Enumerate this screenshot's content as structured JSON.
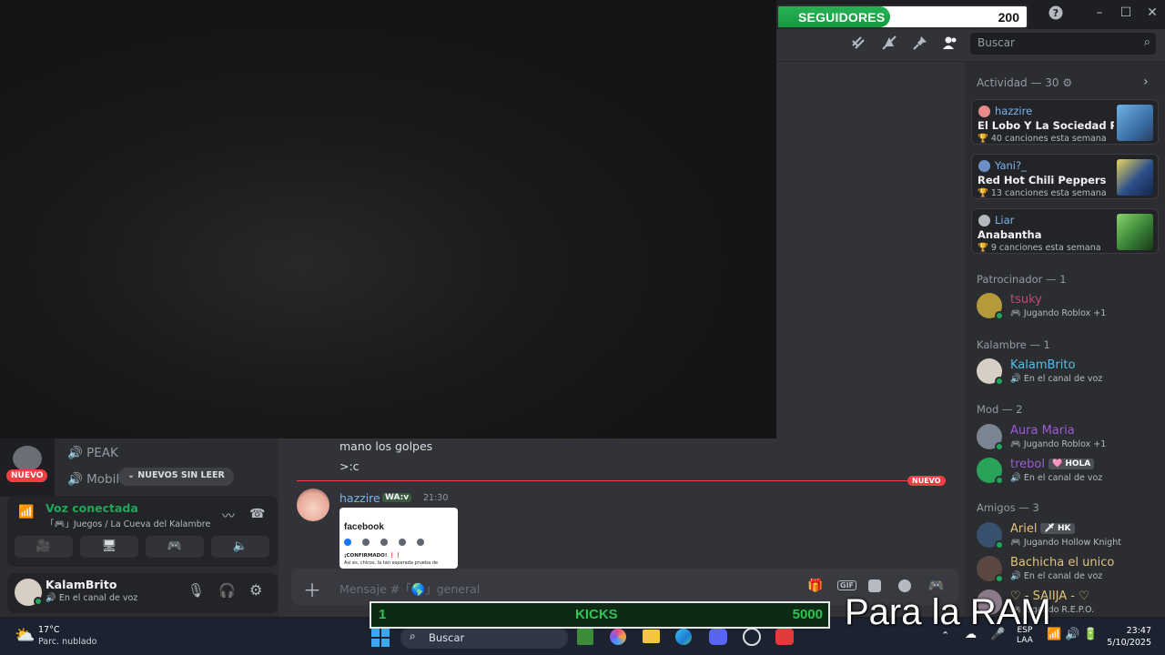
{
  "overlay": {
    "followers_label": "SEGUIDORES",
    "followers_value": "200",
    "followers_progress": 0.45,
    "kicks_left": "1",
    "kicks_label": "KICKS",
    "kicks_right": "5000",
    "caption": "Para la RAM"
  },
  "toolbar": {
    "search_placeholder": "Buscar",
    "icons": [
      "threads-icon",
      "mute-notifications-icon",
      "pin-icon",
      "members-icon"
    ]
  },
  "channels": {
    "items": [
      {
        "label": "PEAK"
      },
      {
        "label": "Mobile"
      }
    ],
    "new_badge": "NUEVO",
    "unread_pill": "NUEVOS SIN LEER"
  },
  "voice": {
    "status": "Voz conectada",
    "channel": "「🎮」Juegos / La Cueva del Kalambre"
  },
  "user": {
    "name": "KalamBrito",
    "status": "En el canal de voz"
  },
  "chat": {
    "messages": [
      {
        "text": "mano los golpes"
      },
      {
        "text": ">:c"
      }
    ],
    "new_divider": "NUEVO",
    "latest": {
      "author": "hazzire",
      "tag": "WA:v",
      "time": "21:30",
      "embed_brand": "facebook",
      "embed_text1": "¡CONFIRMADO! ❗❗",
      "embed_text2": "Así es, chicos, la tan esperada prueba de"
    },
    "composer_placeholder": "Mensaje #「🌎」general"
  },
  "members": {
    "activity_header": "Actividad — 30",
    "activities": [
      {
        "user": "hazzire",
        "title": "El Lobo Y La Sociedad Priv...",
        "sub": "40 canciones esta semana",
        "color": "#e78a8a",
        "thumb": "#3c6fa8"
      },
      {
        "user": "Yani?_",
        "title": "Red Hot Chili Peppers",
        "sub": "13 canciones esta semana",
        "color": "#6a8fc7",
        "thumb": "#2a4e8a"
      },
      {
        "user": "Liar",
        "title": "Anabantha",
        "sub": "9 canciones esta semana",
        "color": "#b5bac1",
        "thumb": "#3e8a3a"
      }
    ],
    "groups": [
      {
        "header": "Patrocinador — 1",
        "members": [
          {
            "name": "tsuky",
            "sub": "Jugando Roblox +1",
            "color": "#c2477a",
            "av": "#b59a3a"
          }
        ]
      },
      {
        "header": "Kalambre — 1",
        "members": [
          {
            "name": "KalamBrito",
            "sub": "En el canal de voz",
            "color": "#4fc1e9",
            "av": "#d7cfc6"
          }
        ]
      },
      {
        "header": "Mod — 2",
        "members": [
          {
            "name": "Aura Maria",
            "sub": "Jugando Roblox +1",
            "color": "#9b5cd6",
            "av": "#7a8591"
          },
          {
            "name": "trebol",
            "sub": "En el canal de voz",
            "color": "#9b5cd6",
            "av": "#2aa35a",
            "badge": "🩷 HOLA"
          }
        ]
      },
      {
        "header": "Amigos — 3",
        "members": [
          {
            "name": "Ariel",
            "sub": "Jugando Hollow Knight",
            "color": "#e2c37a",
            "av": "#36506e",
            "badge": "🗡 HK"
          },
          {
            "name": "Bachicha el unico",
            "sub": "En el canal de voz",
            "color": "#e2c37a",
            "av": "#5a4840"
          },
          {
            "name": "♡ - SAIIJA - ♡",
            "sub": "Jugando R.E.P.O.",
            "color": "#e2c37a",
            "av": "#8a7a8a"
          }
        ]
      }
    ]
  },
  "taskbar": {
    "weather_temp": "17°C",
    "weather_desc": "Parc. nublado",
    "search_placeholder": "Buscar",
    "lang_top": "ESP",
    "lang_bottom": "LAA",
    "time": "23:47",
    "date": "5/10/2025"
  }
}
